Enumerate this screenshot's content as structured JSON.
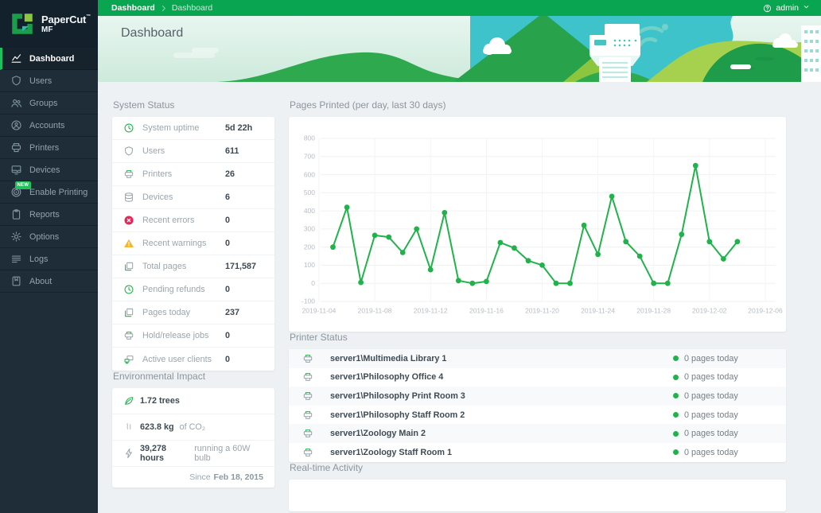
{
  "brand": {
    "name": "PaperCut",
    "tm": "™",
    "sub": "MF"
  },
  "topbar": {
    "breadcrumbs": [
      "Dashboard",
      "Dashboard"
    ],
    "user": "admin"
  },
  "banner": {
    "title": "Dashboard"
  },
  "sidebar": {
    "items": [
      {
        "label": "Dashboard",
        "icon": "dashboard",
        "active": true
      },
      {
        "label": "Users",
        "icon": "users"
      },
      {
        "label": "Groups",
        "icon": "groups"
      },
      {
        "label": "Accounts",
        "icon": "accounts"
      },
      {
        "label": "Printers",
        "icon": "printers"
      },
      {
        "label": "Devices",
        "icon": "devices"
      },
      {
        "label": "Enable Printing",
        "icon": "enable-printing",
        "badge": "NEW"
      },
      {
        "label": "Reports",
        "icon": "reports"
      },
      {
        "label": "Options",
        "icon": "options"
      },
      {
        "label": "Logs",
        "icon": "logs"
      },
      {
        "label": "About",
        "icon": "about"
      }
    ]
  },
  "system_status": {
    "heading": "System Status",
    "rows": [
      {
        "icon": "clock",
        "label": "System uptime",
        "value": "5d 22h"
      },
      {
        "icon": "shield",
        "label": "Users",
        "value": "611"
      },
      {
        "icon": "printer",
        "label": "Printers",
        "value": "26"
      },
      {
        "icon": "database",
        "label": "Devices",
        "value": "6"
      },
      {
        "icon": "error",
        "label": "Recent errors",
        "value": "0"
      },
      {
        "icon": "warning",
        "label": "Recent warnings",
        "value": "0"
      },
      {
        "icon": "pages",
        "label": "Total pages",
        "value": "171,587"
      },
      {
        "icon": "clock",
        "label": "Pending refunds",
        "value": "0"
      },
      {
        "icon": "pages",
        "label": "Pages today",
        "value": "237"
      },
      {
        "icon": "printer",
        "label": "Hold/release jobs",
        "value": "0"
      },
      {
        "icon": "clients",
        "label": "Active user clients",
        "value": "0"
      }
    ]
  },
  "environmental_impact": {
    "heading": "Environmental Impact",
    "rows": [
      {
        "icon": "leaf",
        "bold": "1.72 trees",
        "rest": ""
      },
      {
        "icon": "smoke",
        "bold": "623.8 kg",
        "rest": "of CO₂"
      },
      {
        "icon": "bolt",
        "bold": "39,278 hours",
        "rest": "running a 60W bulb"
      }
    ],
    "since": {
      "label": "Since",
      "date": "Feb 18, 2015"
    }
  },
  "pages_printed": {
    "heading": "Pages Printed (per day, last 30 days)"
  },
  "printer_status": {
    "heading": "Printer Status",
    "rows": [
      {
        "name": "server1\\Multimedia Library 1",
        "status": "0 pages today"
      },
      {
        "name": "server1\\Philosophy Office 4",
        "status": "0 pages today"
      },
      {
        "name": "server1\\Philosophy Print Room 3",
        "status": "0 pages today"
      },
      {
        "name": "server1\\Philosophy Staff Room 2",
        "status": "0 pages today"
      },
      {
        "name": "server1\\Zoology Main 2",
        "status": "0 pages today"
      },
      {
        "name": "server1\\Zoology Staff Room 1",
        "status": "0 pages today"
      }
    ]
  },
  "realtime_activity": {
    "heading": "Real-time Activity"
  },
  "colors": {
    "brand_green": "#0aa551",
    "chart_line": "#21b24c",
    "error_red": "#e3285a",
    "warning_yellow": "#f6b52a",
    "sidebar_bg": "#1e2d38",
    "content_bg": "#eef1f3"
  },
  "chart_data": {
    "type": "line",
    "title": "Pages Printed (per day, last 30 days)",
    "x": [
      "2019-11-05",
      "2019-11-06",
      "2019-11-07",
      "2019-11-08",
      "2019-11-09",
      "2019-11-10",
      "2019-11-11",
      "2019-11-12",
      "2019-11-13",
      "2019-11-14",
      "2019-11-15",
      "2019-11-16",
      "2019-11-17",
      "2019-11-18",
      "2019-11-19",
      "2019-11-20",
      "2019-11-21",
      "2019-11-22",
      "2019-11-23",
      "2019-11-24",
      "2019-11-25",
      "2019-11-26",
      "2019-11-27",
      "2019-11-28",
      "2019-11-29",
      "2019-11-30",
      "2019-12-01",
      "2019-12-02",
      "2019-12-03",
      "2019-12-04"
    ],
    "values": [
      200,
      420,
      5,
      265,
      255,
      170,
      300,
      75,
      390,
      15,
      0,
      10,
      225,
      195,
      125,
      100,
      0,
      0,
      320,
      160,
      480,
      230,
      150,
      0,
      0,
      270,
      650,
      230,
      135,
      230
    ],
    "x_ticks": [
      "2019-11-04",
      "2019-11-08",
      "2019-11-12",
      "2019-11-16",
      "2019-11-20",
      "2019-11-24",
      "2019-11-28",
      "2019-12-02",
      "2019-12-06"
    ],
    "y_ticks": [
      800,
      700,
      600,
      500,
      400,
      300,
      200,
      100,
      0,
      -100
    ],
    "ylim": [
      -100,
      800
    ],
    "xlabel": "",
    "ylabel": "",
    "grid": true,
    "legend": false,
    "line_color": "#21b24c"
  }
}
